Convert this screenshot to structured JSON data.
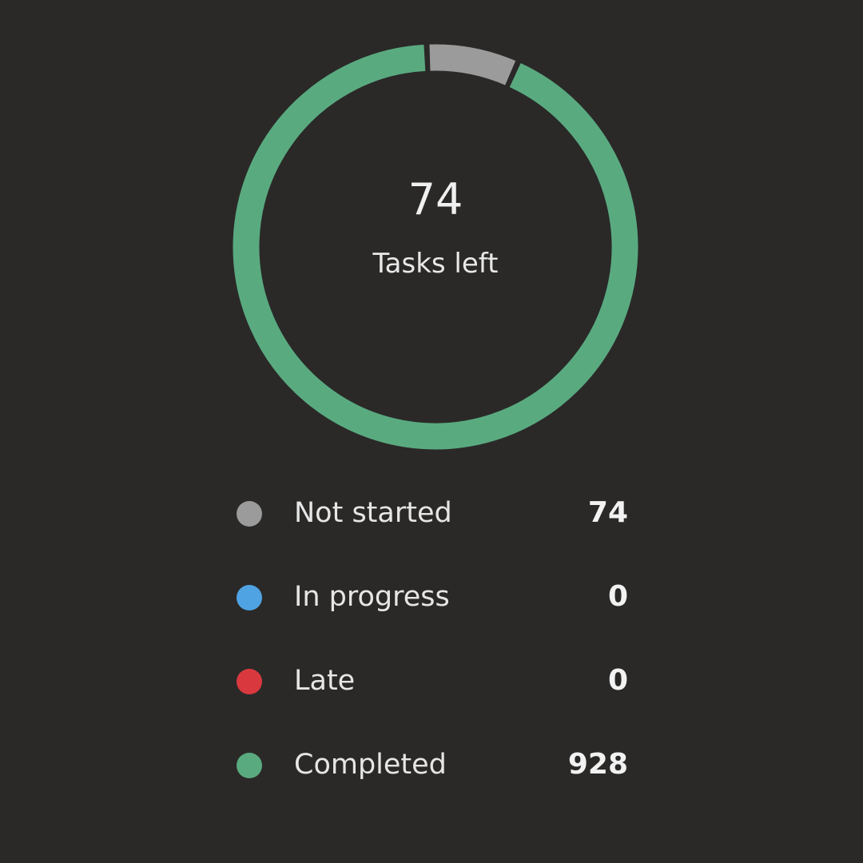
{
  "summary": {
    "value": "74",
    "label": "Tasks left"
  },
  "chart_data": {
    "type": "pie",
    "categories": [
      "Not started",
      "In progress",
      "Late",
      "Completed"
    ],
    "values": [
      74,
      0,
      0,
      928
    ],
    "colors": [
      "#9b9b9b",
      "#4fa3e3",
      "#d9393e",
      "#5aaa80"
    ],
    "title": "",
    "legend": "bottom"
  },
  "legend": {
    "items": [
      {
        "label": "Not started",
        "value": "74",
        "color": "#9b9b9b"
      },
      {
        "label": "In progress",
        "value": "0",
        "color": "#4fa3e3"
      },
      {
        "label": "Late",
        "value": "0",
        "color": "#d9393e"
      },
      {
        "label": "Completed",
        "value": "928",
        "color": "#5aaa80"
      }
    ]
  }
}
